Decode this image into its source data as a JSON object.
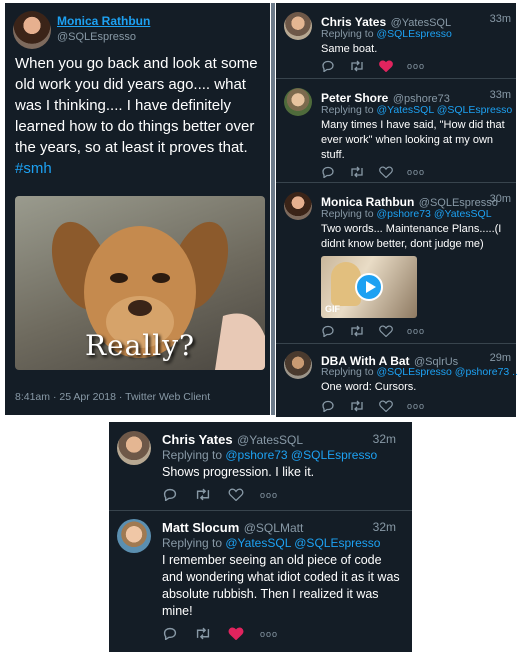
{
  "main_tweet": {
    "author_name": "Monica Rathbun",
    "author_handle": "@SQLEspresso",
    "text_before": "When you go back and look at some old work you did years ago.... what was I thinking.... I have definitely learned how to do things better over the years, so at least it proves that. ",
    "hashtag": "#smh",
    "image_caption": "Really?",
    "footer": "8:41am · 25 Apr 2018 · Twitter Web Client"
  },
  "replies": [
    {
      "name": "Chris Yates",
      "handle": "@YatesSQL",
      "time": "33m",
      "replying_prefix": "Replying to ",
      "replying_to": "@SQLEspresso",
      "text": "Same boat.",
      "liked": true
    },
    {
      "name": "Peter Shore",
      "handle": "@pshore73",
      "time": "33m",
      "replying_prefix": "Replying to ",
      "replying_to": "@YatesSQL @SQLEspresso",
      "text": "Many times I have said, \"How did that ever work\" when looking at my own stuff.",
      "liked": false
    },
    {
      "name": "Monica Rathbun",
      "handle": "@SQLEspresso",
      "time": "30m",
      "replying_prefix": "Replying to ",
      "replying_to": "@pshore73 @YatesSQL",
      "text": "Two words... Maintenance Plans.....(I didnt know better, dont judge me)",
      "media_badge": "GIF",
      "liked": false
    },
    {
      "name": "DBA With A Bat",
      "handle": "@SqlrUs",
      "time": "29m",
      "replying_prefix": "Replying to ",
      "replying_to": "@SQLEspresso @pshore73 ...",
      "text": "One word:  Cursors.",
      "liked": false
    }
  ],
  "bottom_replies": [
    {
      "name": "Chris Yates",
      "handle": "@YatesSQL",
      "time": "32m",
      "replying_prefix": "Replying to ",
      "replying_to": "@pshore73 @SQLEspresso",
      "text": "Shows progression. I like it.",
      "liked": false
    },
    {
      "name": "Matt Slocum",
      "handle": "@SQLMatt",
      "time": "32m",
      "replying_prefix": "Replying to ",
      "replying_to": "@YatesSQL @SQLEspresso",
      "text": "I remember seeing an old piece of code and wondering what idiot coded it as it was absolute rubbish. Then I realized it was mine!",
      "liked": true
    }
  ],
  "icons": [
    "reply-icon",
    "retweet-icon",
    "like-icon",
    "more-icon",
    "play-icon"
  ],
  "colors": {
    "background": "#141d26",
    "link": "#1da1f2",
    "muted": "#8899a6",
    "like_active": "#e0245e"
  }
}
